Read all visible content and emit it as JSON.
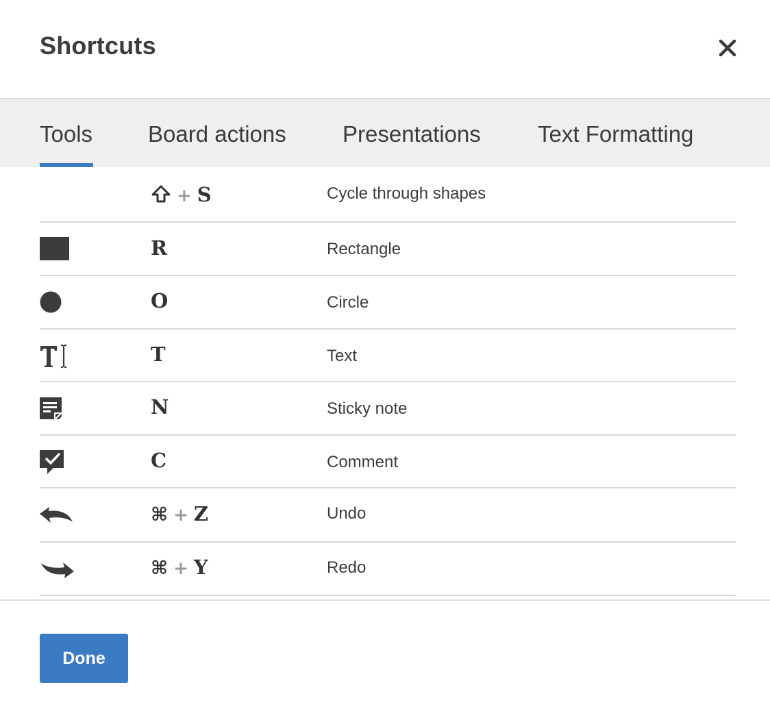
{
  "dialog": {
    "title": "Shortcuts",
    "close_icon": "close-icon"
  },
  "tabs": [
    {
      "label": "Tools",
      "active": true
    },
    {
      "label": "Board actions",
      "active": false
    },
    {
      "label": "Presentations",
      "active": false
    },
    {
      "label": "Text Formatting",
      "active": false
    }
  ],
  "shortcuts": [
    {
      "icon": "",
      "modifier": "shift-icon",
      "key": "S",
      "description": "Cycle through shapes"
    },
    {
      "icon": "rectangle-icon",
      "modifier": "",
      "key": "R",
      "description": "Rectangle"
    },
    {
      "icon": "circle-icon",
      "modifier": "",
      "key": "O",
      "description": "Circle"
    },
    {
      "icon": "text-icon",
      "modifier": "",
      "key": "T",
      "description": "Text"
    },
    {
      "icon": "sticky-note-icon",
      "modifier": "",
      "key": "N",
      "description": "Sticky note"
    },
    {
      "icon": "comment-icon",
      "modifier": "",
      "key": "C",
      "description": "Comment"
    },
    {
      "icon": "undo-icon",
      "modifier": "⌘",
      "key": "Z",
      "description": "Undo"
    },
    {
      "icon": "redo-icon",
      "modifier": "⌘",
      "key": "Y",
      "description": "Redo"
    }
  ],
  "plus_symbol": "+",
  "footer": {
    "done_label": "Done"
  },
  "colors": {
    "accent": "#3b7bc4",
    "tab_bar": "#efefef",
    "icon": "#3c3c3c"
  }
}
